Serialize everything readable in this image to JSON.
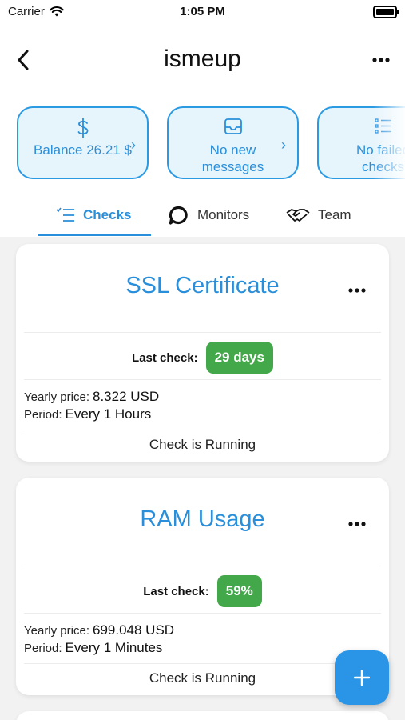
{
  "status_bar": {
    "carrier": "Carrier",
    "time": "1:05 PM"
  },
  "header": {
    "title": "ismeup"
  },
  "summary_cards": [
    {
      "icon": "dollar-icon",
      "label": "Balance 26.21 $"
    },
    {
      "icon": "inbox-icon",
      "label": "No new messages"
    },
    {
      "icon": "checklist-icon",
      "label": "No failed checks"
    }
  ],
  "tabs": [
    {
      "label": "Checks",
      "icon": "checklist-icon",
      "active": true
    },
    {
      "label": "Monitors",
      "icon": "speech-bubble-icon",
      "active": false
    },
    {
      "label": "Team",
      "icon": "handshake-icon",
      "active": false
    }
  ],
  "checks": [
    {
      "title": "SSL Certificate",
      "last_check_label": "Last check:",
      "last_check_value": "29 days",
      "yearly_price_label": "Yearly price:",
      "yearly_price_value": "8.322 USD",
      "period_label": "Period:",
      "period_value": "Every 1 Hours",
      "status": "Check is Running"
    },
    {
      "title": "RAM Usage",
      "last_check_label": "Last check:",
      "last_check_value": "59%",
      "yearly_price_label": "Yearly price:",
      "yearly_price_value": "699.048 USD",
      "period_label": "Period:",
      "period_value": "Every 1 Minutes",
      "status": "Check is Running"
    }
  ],
  "colors": {
    "accent": "#2a8fda",
    "badge_green": "#43a84a",
    "card_fill": "#e6f4fc"
  }
}
